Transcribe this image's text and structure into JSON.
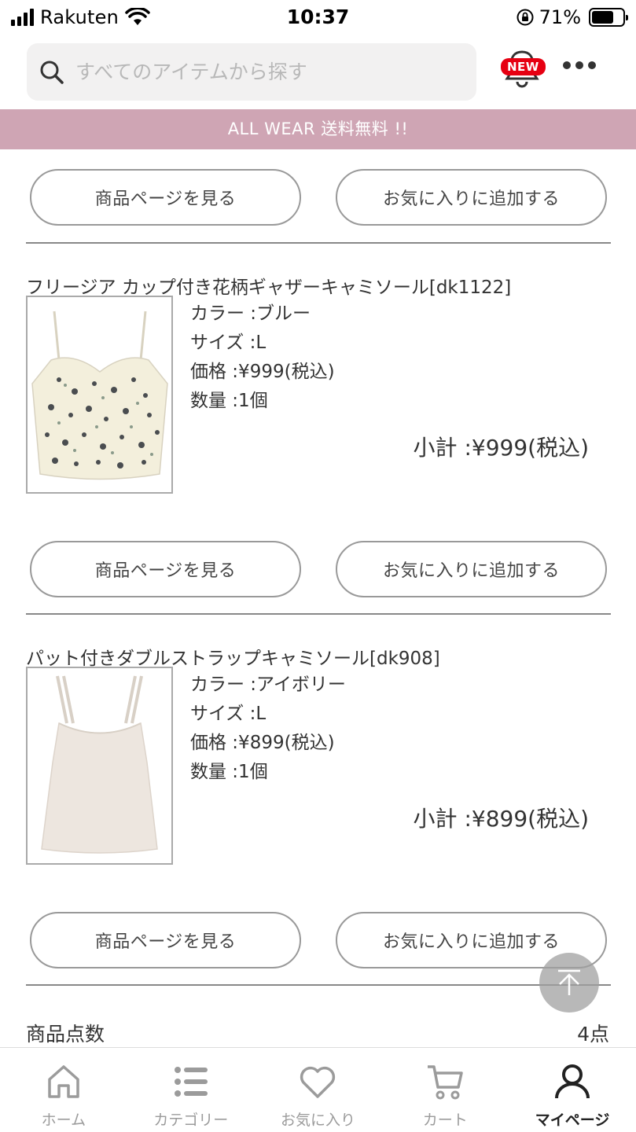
{
  "status_bar": {
    "carrier": "Rakuten",
    "time": "10:37",
    "battery_percent": "71%",
    "battery_level": 0.71
  },
  "header": {
    "search_placeholder": "すべてのアイテムから探す",
    "new_badge": "NEW"
  },
  "banner": {
    "text": "ALL WEAR 送料無料 !!"
  },
  "buttons": {
    "view_product": "商品ページを見る",
    "add_favorite": "お気に入りに追加する"
  },
  "items": [
    {
      "title": "フリージア カップ付き花柄ギャザーキャミソール[dk1122]",
      "color": "カラー :ブルー",
      "size": "サイズ :L",
      "price": "価格 :¥999(税込)",
      "quantity": "数量 :1個",
      "subtotal": "小計 :¥999(税込)"
    },
    {
      "title": "パット付きダブルストラップキャミソール[dk908]",
      "color": "カラー :アイボリー",
      "size": "サイズ :L",
      "price": "価格 :¥899(税込)",
      "quantity": "数量 :1個",
      "subtotal": "小計 :¥899(税込)"
    }
  ],
  "summary": {
    "label": "商品点数",
    "value": "4点"
  },
  "tabs": [
    {
      "label": "ホーム",
      "icon": "home-icon",
      "active": false
    },
    {
      "label": "カテゴリー",
      "icon": "list-icon",
      "active": false
    },
    {
      "label": "お気に入り",
      "icon": "heart-icon",
      "active": false
    },
    {
      "label": "カート",
      "icon": "cart-icon",
      "active": false
    },
    {
      "label": "マイページ",
      "icon": "user-icon",
      "active": true
    }
  ],
  "colors": {
    "banner": "#cfa5b4",
    "badge": "#e60012"
  }
}
